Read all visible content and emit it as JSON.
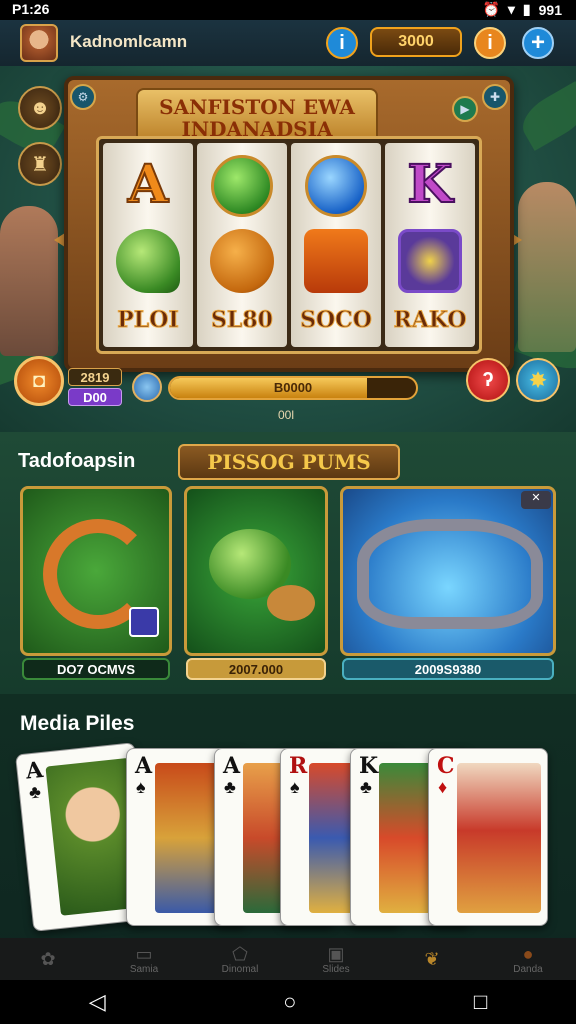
{
  "status_bar": {
    "time": "P1:26",
    "right_text": "991"
  },
  "header": {
    "username": "Kadnomlcamn",
    "info_icon": "i",
    "coins": "3000",
    "help_icon": "i",
    "add_icon": "+"
  },
  "slot": {
    "title_line1": "SANFISTON EWA",
    "title_line2": "INDANADSIA",
    "reels": [
      {
        "letter": "A",
        "label": "PLOI"
      },
      {
        "letter": "",
        "label": "SL80"
      },
      {
        "letter": "",
        "label": "SOCO"
      },
      {
        "letter": "K",
        "label": "RAKO"
      }
    ],
    "bet_top": "2819",
    "bet_bottom": "D00",
    "progress_label": "B0000",
    "progress_fraction": 0.8,
    "sub_label": "00l"
  },
  "promo": {
    "section_title": "Tadofoapsin",
    "ribbon": "PISSOG PUMS",
    "cards": [
      {
        "label": "DO7 OCMVS"
      },
      {
        "label": "2007.000"
      },
      {
        "label": "2009S9380"
      }
    ]
  },
  "cards_section": {
    "title": "Media Piles",
    "cards": [
      {
        "rank": "A",
        "suit": "♣"
      },
      {
        "rank": "A",
        "suit": "♠"
      },
      {
        "rank": "A",
        "suit": "♣"
      },
      {
        "rank": "R",
        "suit": "♠"
      },
      {
        "rank": "K",
        "suit": "♣"
      },
      {
        "rank": "C",
        "suit": "♦"
      }
    ]
  },
  "bottom_nav": {
    "items": [
      {
        "label": "",
        "icon": "flower-icon"
      },
      {
        "label": "Samia",
        "icon": "bag-icon"
      },
      {
        "label": "Dinomal",
        "icon": "shield-icon"
      },
      {
        "label": "Slides",
        "icon": "tablet-icon"
      },
      {
        "label": "",
        "icon": "paw-icon"
      },
      {
        "label": "Danda",
        "icon": "coin-icon"
      }
    ]
  },
  "colors": {
    "accent": "#f0a21c",
    "blue_button": "#1f8ad8",
    "orange_button": "#e8861e"
  }
}
